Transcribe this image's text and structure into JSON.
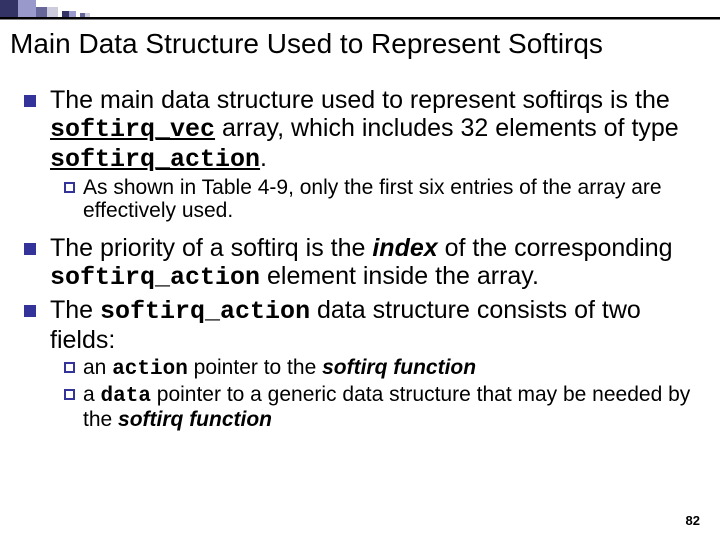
{
  "title": "Main Data Structure Used to Represent Softirqs",
  "bullets": [
    {
      "pre": "The main data structure used to represent softirqs is the ",
      "code1": "softirq_vec",
      "mid": " array, which includes 32 elements of type ",
      "code2": "softirq_action",
      "post": "."
    },
    {
      "text": "As shown in Table 4-9, only the first six entries of the array are effectively used."
    },
    {
      "pre": "The priority of a softirq is the ",
      "boldItalic": "index",
      "mid": " of the corresponding ",
      "code": "softirq_action",
      "post": " element inside the array."
    },
    {
      "pre": "The ",
      "code": "softirq_action",
      "post": " data structure consists of two fields:"
    },
    {
      "pre": "an ",
      "code": "action",
      "mid": " pointer to the ",
      "boldItalic": "softirq function"
    },
    {
      "pre": "a ",
      "code": "data",
      "mid": " pointer to a generic data structure that may be needed by the ",
      "boldItalic": "softirq function"
    }
  ],
  "pageNumber": "82",
  "accentColors": {
    "dark": "#333366",
    "mid": "#666699",
    "light": "#9999cc",
    "pale": "#ccccdd"
  }
}
